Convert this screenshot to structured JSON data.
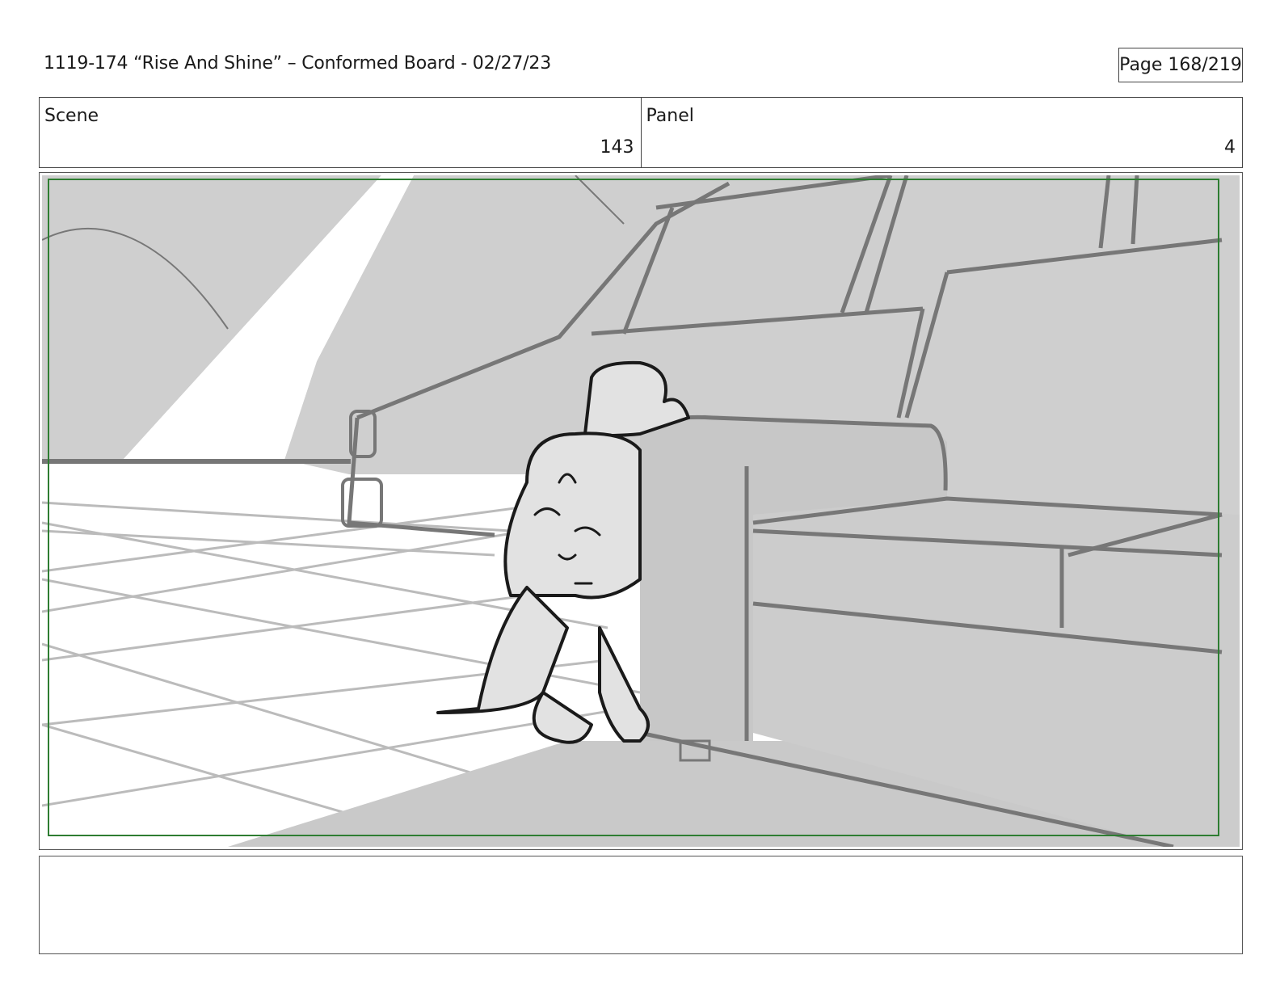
{
  "header": {
    "title": "1119-174 “Rise And Shine” – Conformed Board - 02/27/23",
    "page": "Page 168/219"
  },
  "scene": {
    "label": "Scene",
    "value": "143"
  },
  "panel": {
    "label": "Panel",
    "value": "4"
  },
  "artwork": {
    "description_icon": "storyboard-drawing",
    "safe_frame_color": "#2e7d32",
    "fill_gray": "#cccccc",
    "line_gray": "#777777"
  },
  "notes": {
    "text": ""
  }
}
